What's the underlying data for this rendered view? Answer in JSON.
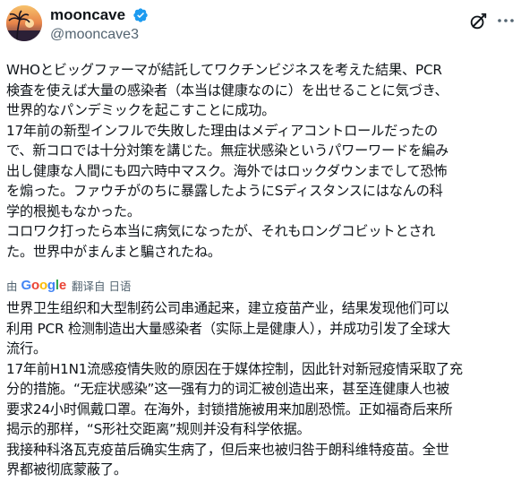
{
  "user": {
    "display_name": "mooncave",
    "handle": "@mooncave3",
    "verified": true
  },
  "icons": {
    "verified": "verified-badge-icon",
    "grok": "grok-icon",
    "more": "more-icon"
  },
  "colors": {
    "verified_blue": "#1d9bf0",
    "text": "#0f1419",
    "secondary": "#536471"
  },
  "tweet": {
    "original_lines": [
      "WHOとビッグファーマが結託してワクチンビジネスを考えた結果、PCR",
      "検査を使えば大量の感染者（本当は健康なのに）を出せることに気づき、",
      "世界的なパンデミックを起こすことに成功。",
      "17年前の新型インフルで失敗した理由はメディアコントロールだったの",
      "で、新コロでは十分対策を講じた。無症状感染というパワーワードを編み",
      "出し健康な人間にも四六時中マスク。海外ではロックダウンまでして恐怖",
      "を煽った。ファウチがのちに暴露したようにSディスタンスにはなんの科",
      "学的根拠もなかった。",
      "コロワク打ったら本当に病気になったが、それもロングコビットとされ",
      "た。世界中がまんまと騙されたね。"
    ],
    "translate_bar": {
      "by_label": "由",
      "google_letters": [
        "G",
        "o",
        "o",
        "g",
        "l",
        "e"
      ],
      "translated_from": "翻译自 日语"
    },
    "translated_lines": [
      "世界卫生组织和大型制药公司串通起来，建立疫苗产业，结果发现他们可以",
      "利用 PCR 检测制造出大量感染者（实际上是健康人），并成功引发了全球大",
      "流行。",
      "17年前H1N1流感疫情失败的原因在于媒体控制，因此针对新冠疫情采取了充",
      "分的措施。“无症状感染”这一强有力的词汇被创造出来，甚至连健康人也被",
      "要求24小时佩戴口罩。在海外，封锁措施被用来加剧恐慌。正如福奇后来所",
      "揭示的那样，“S形社交距离”规则并没有科学依据。",
      "我接种科洛瓦克疫苗后确实生病了，但后来也被归咎于朗科维特疫苗。全世",
      "界都被彻底蒙蔽了。"
    ]
  }
}
